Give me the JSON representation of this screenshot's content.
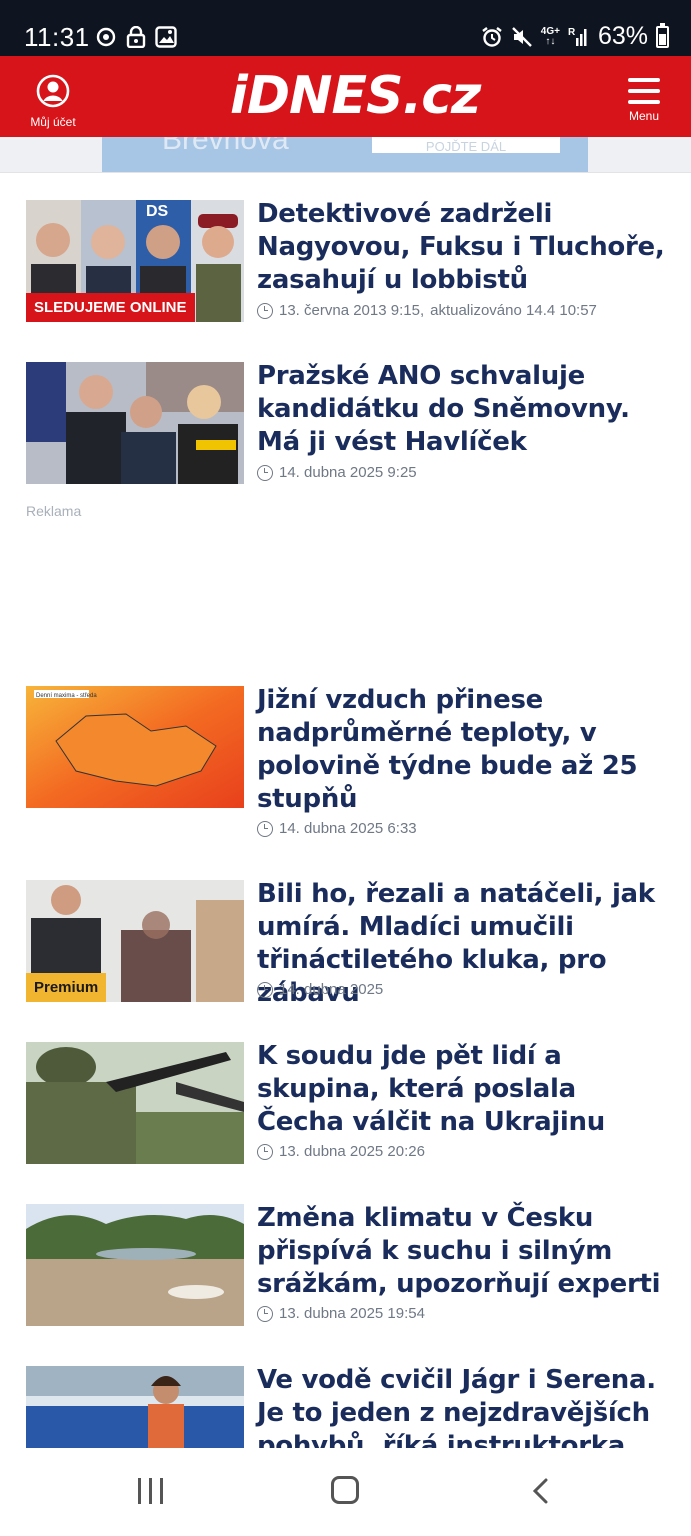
{
  "status_bar": {
    "time": "11:31",
    "network": "4G+",
    "network_sub": "R",
    "battery": "63%",
    "left_icons": [
      "sync-icon",
      "lock-icon",
      "image-icon"
    ],
    "right_icons": [
      "alarm-icon",
      "mute-icon",
      "signal-icon",
      "battery-icon"
    ]
  },
  "header": {
    "account_label": "Můj účet",
    "logo": "iDNES.cz",
    "menu_label": "Menu",
    "brand_color": "#d7141a"
  },
  "ad": {
    "text": "Břevnova",
    "button": "POJĎTE DÁL"
  },
  "reklama": "Reklama",
  "articles": [
    {
      "title": "Detektivové zadrželi Nagyovou, Fuksu i Tluchoře, zasahují u lobbistů",
      "date": "13. června 2013  9:15,",
      "updated": "aktualizováno  14.4 10:57",
      "badge": "SLEDUJEME ONLINE"
    },
    {
      "title": "Pražské ANO schvaluje kandidátku do Sněmovny. Má ji vést Havlíček",
      "date": "14. dubna 2025  9:25"
    },
    {
      "title": "Jižní vzduch přinese nadprůměrné teploty, v polovině týdne bude až 25 stupňů",
      "date": "14. dubna 2025  6:33",
      "thumb_caption": "Denní maxima - středa"
    },
    {
      "title": "Bili ho, řezali a natáčeli, jak umírá. Mladíci umučili třináctiletého kluka, pro zábavu",
      "date": "14. dubna 2025",
      "badge": "Premium"
    },
    {
      "title": "K soudu jde pět lidí a skupina, která poslala Čecha válčit na Ukrajinu",
      "date": "13. dubna 2025  20:26"
    },
    {
      "title": "Změna klimatu v Česku přispívá k suchu i silným srážkám, upozorňují experti",
      "date": "13. dubna 2025  19:54"
    },
    {
      "title": "Ve vodě cvičil Jágr i Serena. Je to jeden z nejzdravějších pohybů, říká instruktorka"
    }
  ],
  "nav": {
    "recents": "recents-icon",
    "home": "home-icon",
    "back": "back-icon"
  }
}
